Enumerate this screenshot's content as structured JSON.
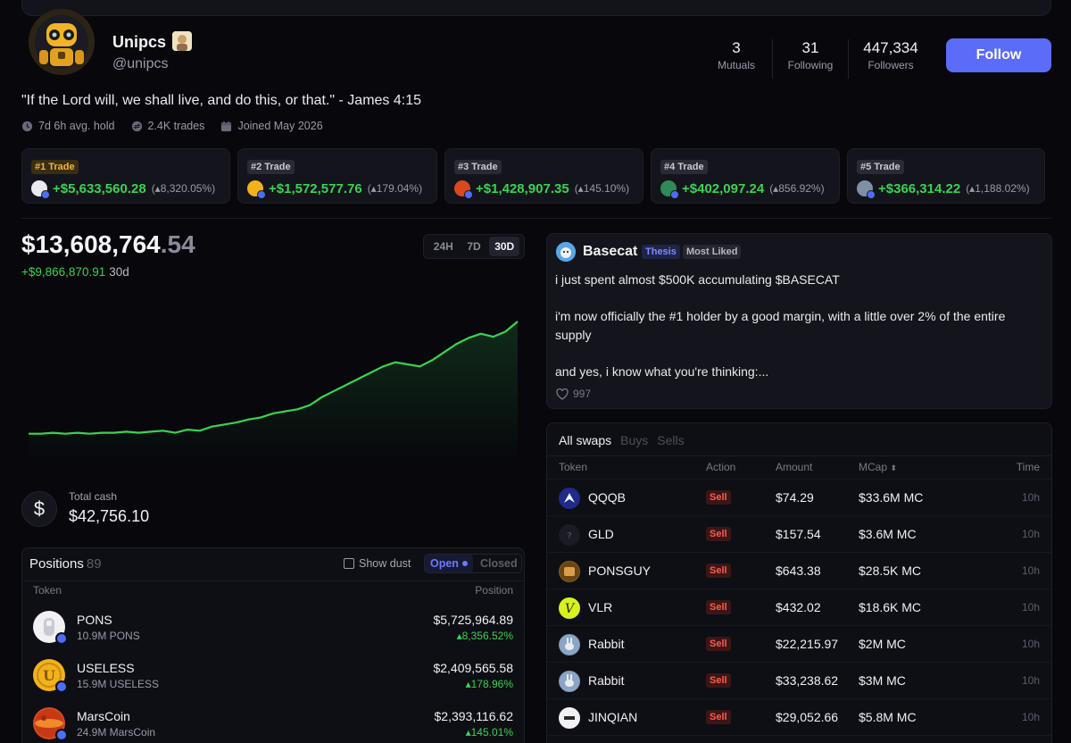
{
  "profile": {
    "name": "Unipcs",
    "handle": "@unipcs",
    "bio": "\"If the Lord will, we shall live, and do this, or that.\" - James 4:15",
    "avg_hold": "7d 6h avg. hold",
    "trades": "2.4K trades",
    "joined": "Joined May 2026",
    "stats": [
      {
        "value": "3",
        "label": "Mutuals"
      },
      {
        "value": "31",
        "label": "Following"
      },
      {
        "value": "447,334",
        "label": "Followers"
      }
    ],
    "follow_label": "Follow",
    "accent_color": "#5b6cf9"
  },
  "top_trades": [
    {
      "rank": "#1 Trade",
      "pnl": "+$5,633,560.28",
      "pct": "8,320.05%",
      "token_icon": "pons-icon"
    },
    {
      "rank": "#2 Trade",
      "pnl": "+$1,572,577.76",
      "pct": "179.04%",
      "token_icon": "useless-icon"
    },
    {
      "rank": "#3 Trade",
      "pnl": "+$1,428,907.35",
      "pct": "145.10%",
      "token_icon": "marscoin-icon"
    },
    {
      "rank": "#4 Trade",
      "pnl": "+$402,097.24",
      "pct": "856.92%",
      "token_icon": "token-icon"
    },
    {
      "rank": "#5 Trade",
      "pnl": "+$366,314.22",
      "pct": "1,188.02%",
      "token_icon": "token-icon"
    }
  ],
  "portfolio": {
    "value_main": "$13,608,764",
    "value_dec": ".54",
    "change": "+$9,866,870.91",
    "period": "30d",
    "timeframes": [
      "24H",
      "7D",
      "30D"
    ],
    "active_timeframe": "30D",
    "cash_label": "Total cash",
    "cash_value": "$42,756.10",
    "positive_color": "#39d353"
  },
  "chart_data": {
    "type": "area",
    "y": [
      0.3,
      0.3,
      0.31,
      0.3,
      0.31,
      0.3,
      0.31,
      0.31,
      0.32,
      0.31,
      0.32,
      0.33,
      0.31,
      0.34,
      0.33,
      0.37,
      0.39,
      0.41,
      0.44,
      0.46,
      0.5,
      0.52,
      0.54,
      0.58,
      0.66,
      0.72,
      0.78,
      0.84,
      0.9,
      0.96,
      1.0,
      0.98,
      0.96,
      1.02,
      1.1,
      1.18,
      1.24,
      1.28,
      1.25,
      1.3,
      1.4
    ]
  },
  "positions": {
    "title": "Positions",
    "count": "89",
    "show_dust": "Show dust",
    "open": "Open",
    "closed": "Closed",
    "col_token": "Token",
    "col_position": "Position",
    "rows": [
      {
        "name": "PONS",
        "amount": "10.9M PONS",
        "value": "$5,725,964.89",
        "pct": "8,356.52%"
      },
      {
        "name": "USELESS",
        "amount": "15.9M USELESS",
        "value": "$2,409,565.58",
        "pct": "178.96%"
      },
      {
        "name": "MarsCoin",
        "amount": "24.9M MarsCoin",
        "value": "$2,393,116.62",
        "pct": "145.01%"
      }
    ]
  },
  "thesis": {
    "author": "Basecat",
    "tag_thesis": "Thesis",
    "tag_liked": "Most Liked",
    "paragraphs": [
      "i just spent almost $500K accumulating $BASECAT",
      "i'm now officially the #1 holder by a good margin, with a little over 2% of the entire supply",
      "and yes, i know what you're thinking:..."
    ],
    "likes": "997"
  },
  "swaps": {
    "tabs": [
      "All swaps",
      "Buys",
      "Sells"
    ],
    "columns": {
      "token": "Token",
      "action": "Action",
      "amount": "Amount",
      "mcap": "MCap",
      "time": "Time"
    },
    "rows": [
      {
        "token": "QQQB",
        "action": "Sell",
        "amount": "$74.29",
        "mcap": "$33.6M MC",
        "time": "10h"
      },
      {
        "token": "GLD",
        "action": "Sell",
        "amount": "$157.54",
        "mcap": "$3.6M MC",
        "time": "10h"
      },
      {
        "token": "PONSGUY",
        "action": "Sell",
        "amount": "$643.38",
        "mcap": "$28.5K MC",
        "time": "10h"
      },
      {
        "token": "VLR",
        "action": "Sell",
        "amount": "$432.02",
        "mcap": "$18.6K MC",
        "time": "10h"
      },
      {
        "token": "Rabbit",
        "action": "Sell",
        "amount": "$22,215.97",
        "mcap": "$2M MC",
        "time": "10h"
      },
      {
        "token": "Rabbit",
        "action": "Sell",
        "amount": "$33,238.62",
        "mcap": "$3M MC",
        "time": "10h"
      },
      {
        "token": "JINQIAN",
        "action": "Sell",
        "amount": "$29,052.66",
        "mcap": "$5.8M MC",
        "time": "10h"
      }
    ],
    "sell_color": "#ff5a4e"
  }
}
